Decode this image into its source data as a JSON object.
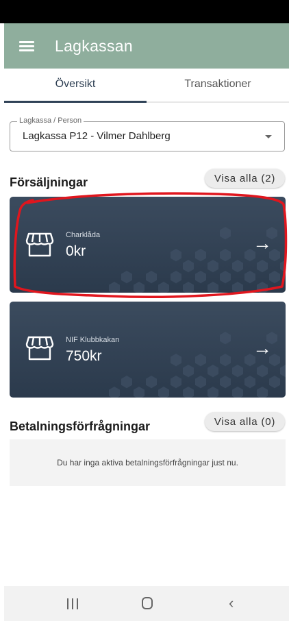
{
  "app": {
    "title": "Lagkassan",
    "icons": {
      "menu": "menu-icon"
    }
  },
  "tabs": [
    {
      "label": "Översikt",
      "active": true
    },
    {
      "label": "Transaktioner",
      "active": false
    }
  ],
  "selector": {
    "legend": "Lagkassa / Person",
    "value": "Lagkassa P12 - Vilmer Dahlberg"
  },
  "sales": {
    "title": "Försäljningar",
    "show_all": "Visa alla (2)",
    "items": [
      {
        "name": "Charklåda",
        "amount": "0kr"
      },
      {
        "name": "NIF Klubbkakan",
        "amount": "750kr"
      }
    ]
  },
  "payments": {
    "title": "Betalningsförfrågningar",
    "show_all": "Visa alla (0)",
    "empty_text": "Du har inga aktiva betalningsförfrågningar just nu."
  },
  "colors": {
    "appbar": "#8fae9d",
    "card": "#334356",
    "annotation": "#e0161e",
    "tab_indicator": "#2f4257"
  }
}
